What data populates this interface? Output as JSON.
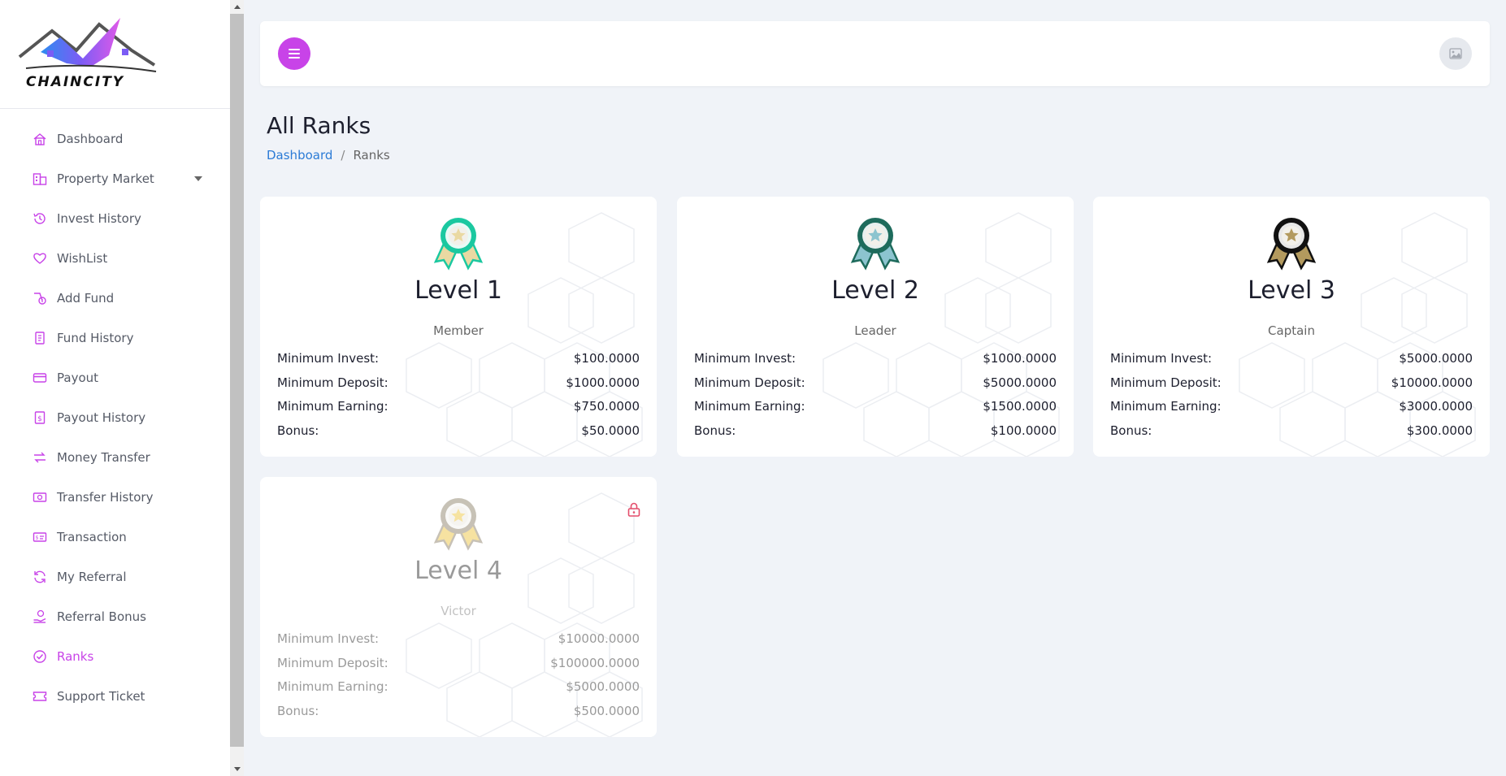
{
  "brand": {
    "name": "CHAINCITY"
  },
  "sidebar": {
    "items": [
      {
        "label": "Dashboard",
        "icon": "home-icon"
      },
      {
        "label": "Property Market",
        "icon": "buildings-icon"
      },
      {
        "label": "Invest History",
        "icon": "history-icon"
      },
      {
        "label": "WishList",
        "icon": "heart-icon"
      },
      {
        "label": "Add Fund",
        "icon": "wallet-icon"
      },
      {
        "label": "Fund History",
        "icon": "receipt-icon"
      },
      {
        "label": "Payout",
        "icon": "credit-card-icon"
      },
      {
        "label": "Payout History",
        "icon": "dollar-document-icon"
      },
      {
        "label": "Money Transfer",
        "icon": "transfer-icon"
      },
      {
        "label": "Transfer History",
        "icon": "money-icon"
      },
      {
        "label": "Transaction",
        "icon": "transaction-icon"
      },
      {
        "label": "My Referral",
        "icon": "refresh-icon"
      },
      {
        "label": "Referral Bonus",
        "icon": "hand-coin-icon"
      },
      {
        "label": "Ranks",
        "icon": "badge-check-icon"
      },
      {
        "label": "Support Ticket",
        "icon": "ticket-icon"
      }
    ],
    "active_index": 13
  },
  "page": {
    "title": "All Ranks",
    "breadcrumb": {
      "home": "Dashboard",
      "current": "Ranks",
      "separator": "/"
    }
  },
  "ranks": [
    {
      "level": "Level 1",
      "name": "Member",
      "locked": false,
      "medal_color": "#1bc8a0",
      "ribbon_color": "#ead9a2",
      "rows": [
        {
          "label": "Minimum Invest:",
          "value": "$100.0000"
        },
        {
          "label": "Minimum Deposit:",
          "value": "$1000.0000"
        },
        {
          "label": "Minimum Earning:",
          "value": "$750.0000"
        },
        {
          "label": "Bonus:",
          "value": "$50.0000"
        }
      ]
    },
    {
      "level": "Level 2",
      "name": "Leader",
      "locked": false,
      "medal_color": "#1e6b5c",
      "ribbon_color": "#8cc4cf",
      "rows": [
        {
          "label": "Minimum Invest:",
          "value": "$1000.0000"
        },
        {
          "label": "Minimum Deposit:",
          "value": "$5000.0000"
        },
        {
          "label": "Minimum Earning:",
          "value": "$1500.0000"
        },
        {
          "label": "Bonus:",
          "value": "$100.0000"
        }
      ]
    },
    {
      "level": "Level 3",
      "name": "Captain",
      "locked": false,
      "medal_color": "#111111",
      "ribbon_color": "#b39a5e",
      "rows": [
        {
          "label": "Minimum Invest:",
          "value": "$5000.0000"
        },
        {
          "label": "Minimum Deposit:",
          "value": "$10000.0000"
        },
        {
          "label": "Minimum Earning:",
          "value": "$3000.0000"
        },
        {
          "label": "Bonus:",
          "value": "$300.0000"
        }
      ]
    },
    {
      "level": "Level 4",
      "name": "Victor",
      "locked": true,
      "medal_color": "#b0a898",
      "ribbon_color": "#f3d77a",
      "rows": [
        {
          "label": "Minimum Invest:",
          "value": "$10000.0000"
        },
        {
          "label": "Minimum Deposit:",
          "value": "$100000.0000"
        },
        {
          "label": "Minimum Earning:",
          "value": "$5000.0000"
        },
        {
          "label": "Bonus:",
          "value": "$500.0000"
        }
      ]
    }
  ],
  "colors": {
    "accent": "#c843e8",
    "link": "#2b7bd6",
    "lock": "#e44d6b"
  }
}
